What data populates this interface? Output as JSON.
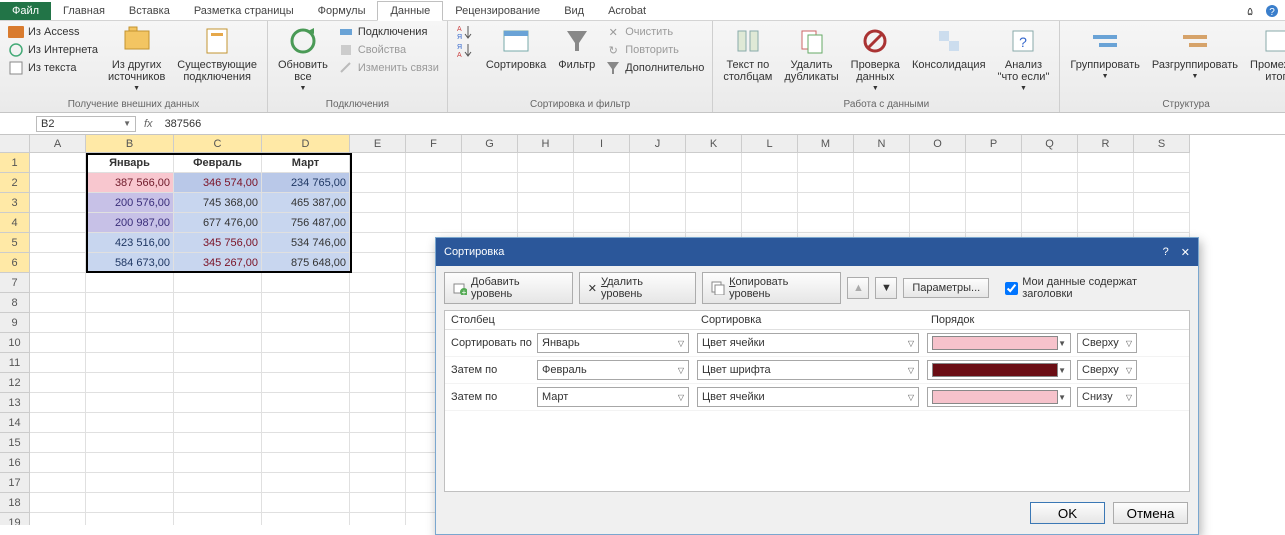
{
  "tabs": {
    "file": "Файл",
    "home": "Главная",
    "insert": "Вставка",
    "layout": "Разметка страницы",
    "formulas": "Формулы",
    "data": "Данные",
    "review": "Рецензирование",
    "view": "Вид",
    "acrobat": "Acrobat"
  },
  "ribbon": {
    "external_data": {
      "title": "Получение внешних данных",
      "access": "Из Access",
      "web": "Из Интернета",
      "text": "Из текста",
      "other": "Из других\nисточников",
      "existing": "Существующие\nподключения"
    },
    "connections": {
      "title": "Подключения",
      "refresh": "Обновить\nвсе",
      "conn": "Подключения",
      "props": "Свойства",
      "editlinks": "Изменить связи"
    },
    "sortfilter": {
      "title": "Сортировка и фильтр",
      "az": "А↓Я",
      "za": "Я↓А",
      "sort": "Сортировка",
      "filter": "Фильтр",
      "clear": "Очистить",
      "reapply": "Повторить",
      "advanced": "Дополнительно"
    },
    "datatools": {
      "title": "Работа с данными",
      "texttocol": "Текст по\nстолбцам",
      "removedup": "Удалить\nдубликаты",
      "validate": "Проверка\nданных",
      "consolidate": "Консолидация",
      "whatif": "Анализ\n\"что если\""
    },
    "outline": {
      "title": "Структура",
      "group": "Группировать",
      "ungroup": "Разгруппировать",
      "subtotal": "Промежут\nитог"
    }
  },
  "namebox": "B2",
  "formula": "387566",
  "columns": [
    "A",
    "B",
    "C",
    "D",
    "E",
    "F",
    "G",
    "H",
    "I",
    "J",
    "K",
    "L",
    "M",
    "N",
    "O",
    "P",
    "Q",
    "R",
    "S"
  ],
  "table": {
    "headers": [
      "Январь",
      "Февраль",
      "Март"
    ],
    "rows": [
      {
        "b": {
          "v": "387 566,00",
          "bg": "#f8c7cf",
          "fg": "#6e1a2a"
        },
        "c": {
          "v": "346 574,00",
          "bg": "#b9c8e8",
          "fg": "#7a1125"
        },
        "d": {
          "v": "234 765,00",
          "bg": "#b9c8e8",
          "fg": "#1f3763"
        }
      },
      {
        "b": {
          "v": "200 576,00",
          "bg": "#c7c1e7",
          "fg": "#3a2e7a"
        },
        "c": {
          "v": "745 368,00",
          "bg": "#c8d6ef",
          "fg": "#333"
        },
        "d": {
          "v": "465 387,00",
          "bg": "#c8d6ef",
          "fg": "#333"
        }
      },
      {
        "b": {
          "v": "200 987,00",
          "bg": "#c7c1e7",
          "fg": "#3a2e7a"
        },
        "c": {
          "v": "677 476,00",
          "bg": "#c8d6ef",
          "fg": "#333"
        },
        "d": {
          "v": "756 487,00",
          "bg": "#c8d6ef",
          "fg": "#333"
        }
      },
      {
        "b": {
          "v": "423 516,00",
          "bg": "#c8d6ef",
          "fg": "#1f3763"
        },
        "c": {
          "v": "345 756,00",
          "bg": "#c8d6ef",
          "fg": "#7a1125"
        },
        "d": {
          "v": "534 746,00",
          "bg": "#c8d6ef",
          "fg": "#333"
        }
      },
      {
        "b": {
          "v": "584 673,00",
          "bg": "#c8d6ef",
          "fg": "#1f3763"
        },
        "c": {
          "v": "345 267,00",
          "bg": "#c8d6ef",
          "fg": "#7a1125"
        },
        "d": {
          "v": "875 648,00",
          "bg": "#c8d6ef",
          "fg": "#333"
        }
      }
    ]
  },
  "dialog": {
    "title": "Сортировка",
    "add": "Добавить уровень",
    "del": "Удалить уровень",
    "copy": "Копировать уровень",
    "options": "Параметры...",
    "hasheaders": "Мои данные содержат заголовки",
    "h_col": "Столбец",
    "h_sort": "Сортировка",
    "h_order": "Порядок",
    "rows": [
      {
        "lbl": "Сортировать по",
        "col": "Январь",
        "sort": "Цвет ячейки",
        "swatch": "#f6c2cb",
        "pos": "Сверху"
      },
      {
        "lbl": "Затем по",
        "col": "Февраль",
        "sort": "Цвет шрифта",
        "swatch": "#6a0d14",
        "pos": "Сверху"
      },
      {
        "lbl": "Затем по",
        "col": "Март",
        "sort": "Цвет ячейки",
        "swatch": "#f6c2cb",
        "pos": "Снизу"
      }
    ],
    "ok": "OK",
    "cancel": "Отмена"
  }
}
